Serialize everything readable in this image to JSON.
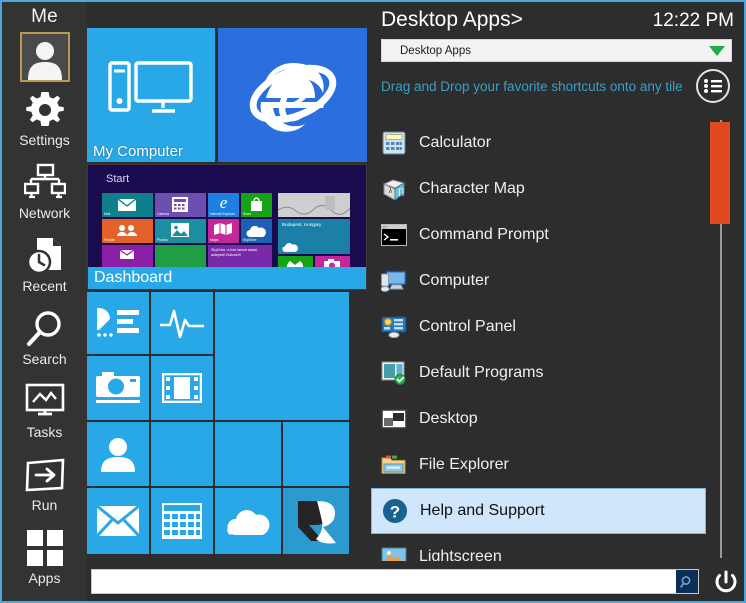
{
  "window": {
    "border_color": "#4ea6dd",
    "background": "#2d2d2d"
  },
  "sidebar": {
    "title": "Me",
    "avatar_name": "user-avatar",
    "items": [
      {
        "label": "Settings",
        "icon": "gear-icon"
      },
      {
        "label": "Network",
        "icon": "network-computers-icon"
      },
      {
        "label": "Recent",
        "icon": "recent-document-clock-icon"
      },
      {
        "label": "Search",
        "icon": "magnifier-icon"
      },
      {
        "label": "Tasks",
        "icon": "monitor-chart-icon"
      },
      {
        "label": "Run",
        "icon": "arrow-right-box-icon"
      },
      {
        "label": "Apps",
        "icon": "four-squares-icon"
      }
    ]
  },
  "tiles": {
    "my_computer": {
      "label": "My Computer",
      "icon": "desktop-computer-icon",
      "color": "#29a8e8"
    },
    "internet_explorer": {
      "label": "",
      "icon": "internet-explorer-icon",
      "color": "#2a6fdd"
    },
    "dashboard": {
      "label": "Dashboard",
      "preview_title": "Start",
      "color": "#29a8e8",
      "preview_background": "#190b4d",
      "preview_tiles": [
        {
          "label": "Mail",
          "color": "#0f7f8c",
          "icon": "mail-icon"
        },
        {
          "label": "Camera",
          "color": "#6c4fb0",
          "icon": "calculator-icon"
        },
        {
          "label": "Internet Explorer",
          "color": "#1f7fe0",
          "icon": "ie-icon"
        },
        {
          "label": "Store",
          "color": "#17a317",
          "icon": "store-bag-icon"
        },
        {
          "label": "",
          "color": "#d8d8d8",
          "icon": "photo-wide-icon"
        },
        {
          "label": "People",
          "color": "#e4622a",
          "icon": "people-icon"
        },
        {
          "label": "Photos",
          "color": "#1b8fa0",
          "icon": "picture-icon"
        },
        {
          "label": "Maps",
          "color": "#c4279a",
          "icon": "maps-icon"
        },
        {
          "label": "SkyDrive",
          "color": "#1d5fb5",
          "icon": "cloud-icon"
        },
        {
          "label": "Budapest, Hungary",
          "color": "#1b7fa8",
          "icon": "weather-cloud-icon"
        },
        {
          "label": "",
          "color": "#8b1fa8",
          "icon": "mail-small-icon"
        },
        {
          "label": "",
          "color": "#1f9e46",
          "icon": "blank-icon"
        },
        {
          "label": "SkyDrive, a fost lansat astazi, asteptati Outlook!!!",
          "color": "#7a2aa8",
          "icon": "news-icon"
        },
        {
          "label": "",
          "color": "#17a317",
          "icon": "xbox-icon"
        },
        {
          "label": "",
          "color": "#c4279a",
          "icon": "camera-small-icon"
        }
      ]
    },
    "grid": [
      {
        "icon": "chart-list-icon",
        "color": "#29a8e8",
        "label": ""
      },
      {
        "icon": "pulse-icon",
        "color": "#29a8e8",
        "label": ""
      },
      {
        "icon": "blank-icon",
        "color": "#29a8e8",
        "label": ""
      },
      {
        "icon": "camera-icon",
        "color": "#29a8e8",
        "label": ""
      },
      {
        "icon": "film-strip-icon",
        "color": "#29a8e8",
        "label": ""
      },
      {
        "icon": "person-icon",
        "color": "#29a8e8",
        "label": ""
      },
      {
        "icon": "blank-icon",
        "color": "#29a8e8",
        "label": ""
      },
      {
        "icon": "blank-icon",
        "color": "#29a8e8",
        "label": ""
      },
      {
        "icon": "envelope-icon",
        "color": "#29a8e8",
        "label": ""
      },
      {
        "icon": "calendar-icon",
        "color": "#29a8e8",
        "label": ""
      },
      {
        "icon": "cloud-icon",
        "color": "#29a8e8",
        "label": ""
      },
      {
        "icon": "r-logo-icon",
        "color": "#2b9bcf",
        "label": ""
      }
    ]
  },
  "right_panel": {
    "title": "Desktop Apps>",
    "clock": "12:22 PM",
    "dropdown": {
      "value": "Desktop Apps",
      "arrow_color": "#1faa4b"
    },
    "hint": "Drag and Drop your favorite shortcuts onto any tile",
    "hint_color": "#3b9fc4",
    "list_button_icon": "list-circle-icon",
    "scrollbar": {
      "thumb_color": "#e04a22",
      "track_color": "#9a9a9a"
    },
    "apps": [
      {
        "label": "Calculator",
        "icon": "calculator-icon",
        "selected": false
      },
      {
        "label": "Character Map",
        "icon": "character-map-icon",
        "selected": false
      },
      {
        "label": "Command Prompt",
        "icon": "command-prompt-icon",
        "selected": false
      },
      {
        "label": "Computer",
        "icon": "computer-icon",
        "selected": false
      },
      {
        "label": "Control Panel",
        "icon": "control-panel-icon",
        "selected": false
      },
      {
        "label": "Default Programs",
        "icon": "default-programs-icon",
        "selected": false
      },
      {
        "label": "Desktop",
        "icon": "desktop-icon",
        "selected": false
      },
      {
        "label": "File Explorer",
        "icon": "file-explorer-icon",
        "selected": false
      },
      {
        "label": "Help and Support",
        "icon": "help-support-icon",
        "selected": true
      },
      {
        "label": "Lightscreen",
        "icon": "lightscreen-icon",
        "selected": false
      }
    ]
  },
  "bottom_bar": {
    "search_value": "",
    "search_placeholder": "",
    "search_button_icon": "magnifier-icon",
    "power_button_icon": "power-icon"
  }
}
